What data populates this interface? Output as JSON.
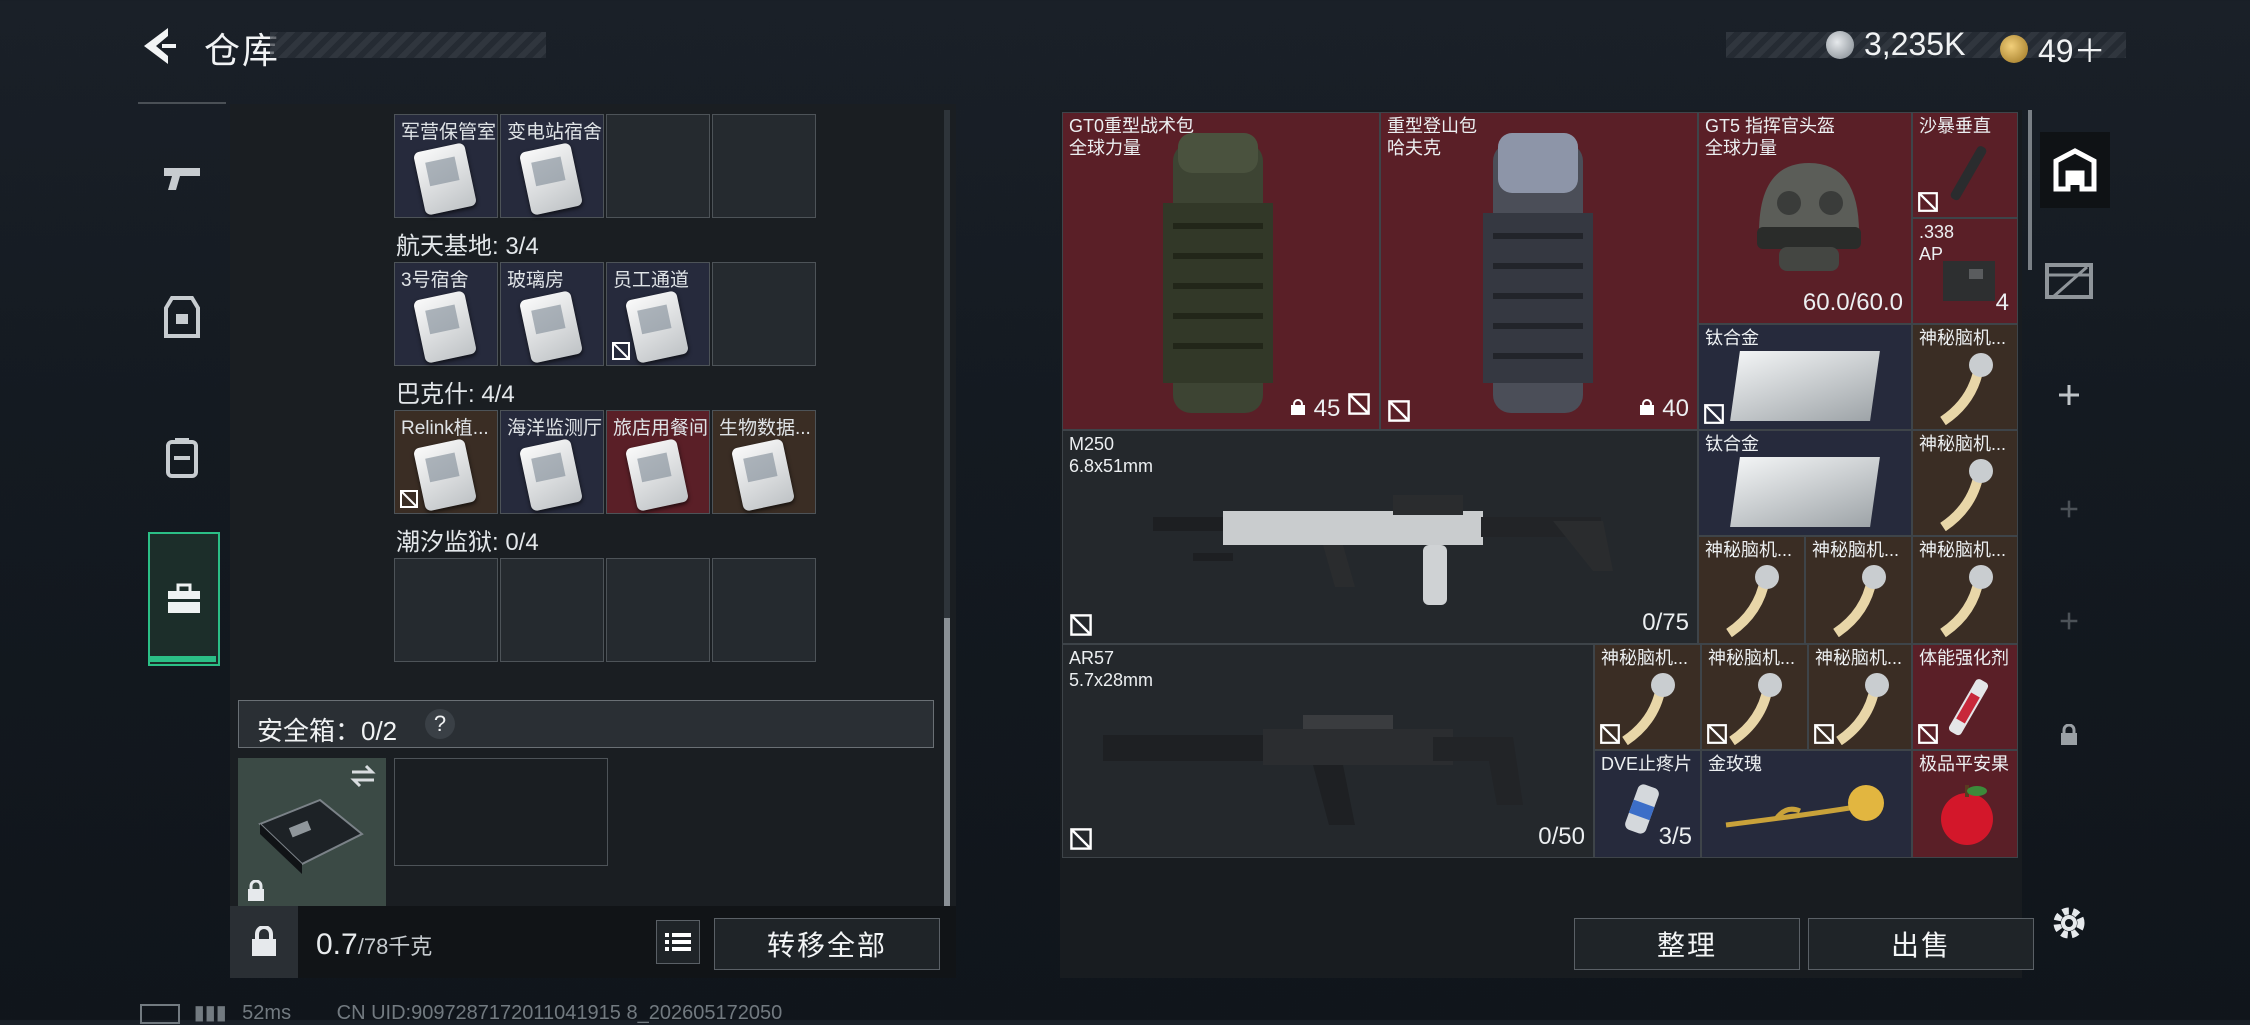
{
  "header": {
    "title": "仓库",
    "currency1": "3,235K",
    "currency2": "49＋"
  },
  "left_rooms": {
    "row0": [
      "军营保管室",
      "变电站宿舍"
    ],
    "section1": "航天基地: 3/4",
    "row1": [
      "3号宿舍",
      "玻璃房",
      "员工通道"
    ],
    "section2": "巴克什: 4/4",
    "row2": [
      "Relink植...",
      "海洋监测厅",
      "旅店用餐间",
      "生物数据..."
    ],
    "section3": "潮汐监狱: 0/4"
  },
  "safe_box": {
    "label": "安全箱：0/2",
    "help": "?"
  },
  "footer": {
    "weight": "0.7",
    "weight_max": "/78千克",
    "transfer_all": "转移全部",
    "build_info": "52ms",
    "uid": "CN UID:9097287172011041915 8_202605172050"
  },
  "items": {
    "gt0": {
      "name": "GT0重型战术包",
      "sub": "全球力量",
      "count": "45"
    },
    "heavy": {
      "name": "重型登山包",
      "sub": "哈夫克",
      "count": "40"
    },
    "gt5": {
      "name": "GT5 指挥官头盔",
      "sub": "全球力量",
      "durability": "60.0/60.0"
    },
    "sand": {
      "name": "沙暴垂直"
    },
    "ammo": {
      "name": ".338",
      "sub": "AP",
      "count": "4"
    },
    "ti1": {
      "name": "钛合金"
    },
    "ti2": {
      "name": "钛合金"
    },
    "myst": "神秘脑机...",
    "m250": {
      "name": "M250",
      "sub": "6.8x51mm",
      "ammo": "0/75"
    },
    "ar57": {
      "name": "AR57",
      "sub": "5.7x28mm",
      "ammo": "0/50"
    },
    "body": {
      "name": "体能强化剂"
    },
    "dve": {
      "name": "DVE止疼片",
      "count": "3/5"
    },
    "rose": {
      "name": "金玫瑰"
    },
    "apple": {
      "name": "极品平安果"
    }
  },
  "buttons": {
    "sort": "整理",
    "sell": "出售"
  },
  "colors": {
    "accent": "#2bbf86",
    "red_cell": "#5a1f27",
    "blue_cell": "#262a3c",
    "brown_cell": "#3a2d24"
  }
}
